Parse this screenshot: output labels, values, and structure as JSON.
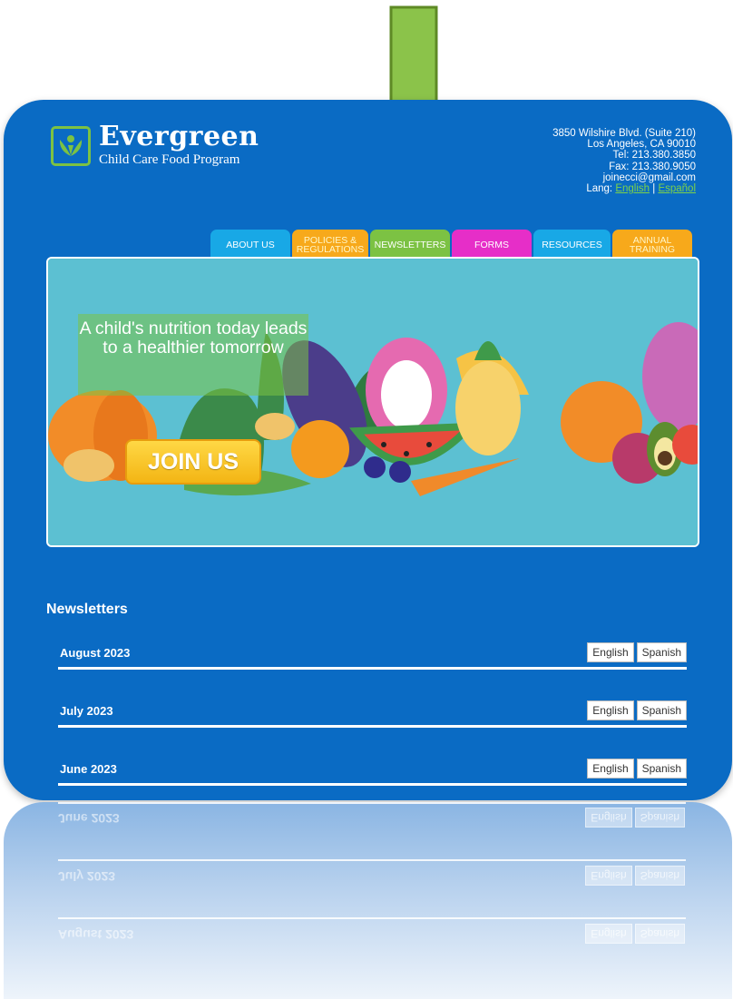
{
  "logo": {
    "title": "Evergreen",
    "subtitle": "Child Care Food Program"
  },
  "contact": {
    "address1": "3850 Wilshire Blvd. (Suite 210)",
    "address2": "Los Angeles, CA 90010",
    "tel": "Tel: 213.380.3850",
    "fax": "Fax: 213.380.9050",
    "email": "joinecci@gmail.com",
    "lang_prefix": "Lang: ",
    "lang_english": "English",
    "lang_sep": " | ",
    "lang_spanish": "Español"
  },
  "nav": {
    "about": "ABOUT US",
    "policies": "POLICIES & REGULATIONS",
    "newsletters": "NEWSLETTERS",
    "forms": "FORMS",
    "resources": "RESOURCES",
    "annual": "ANNUAL TRAINING"
  },
  "banner": {
    "tagline": "A child's nutrition today leads to a healthier tomorrow",
    "cta": "JOIN US"
  },
  "newsletters": {
    "title": "Newsletters",
    "rows": [
      {
        "month": "August 2023",
        "english": "English",
        "spanish": "Spanish"
      },
      {
        "month": "July 2023",
        "english": "English",
        "spanish": "Spanish"
      },
      {
        "month": "June 2023",
        "english": "English",
        "spanish": "Spanish"
      }
    ]
  },
  "colors": {
    "background": "#0a6bc4",
    "brand_green": "#7cc243",
    "tab_blue": "#18a8e6",
    "tab_orange": "#f7a91b",
    "tab_green": "#7cc243",
    "tab_magenta": "#e62ec8"
  }
}
